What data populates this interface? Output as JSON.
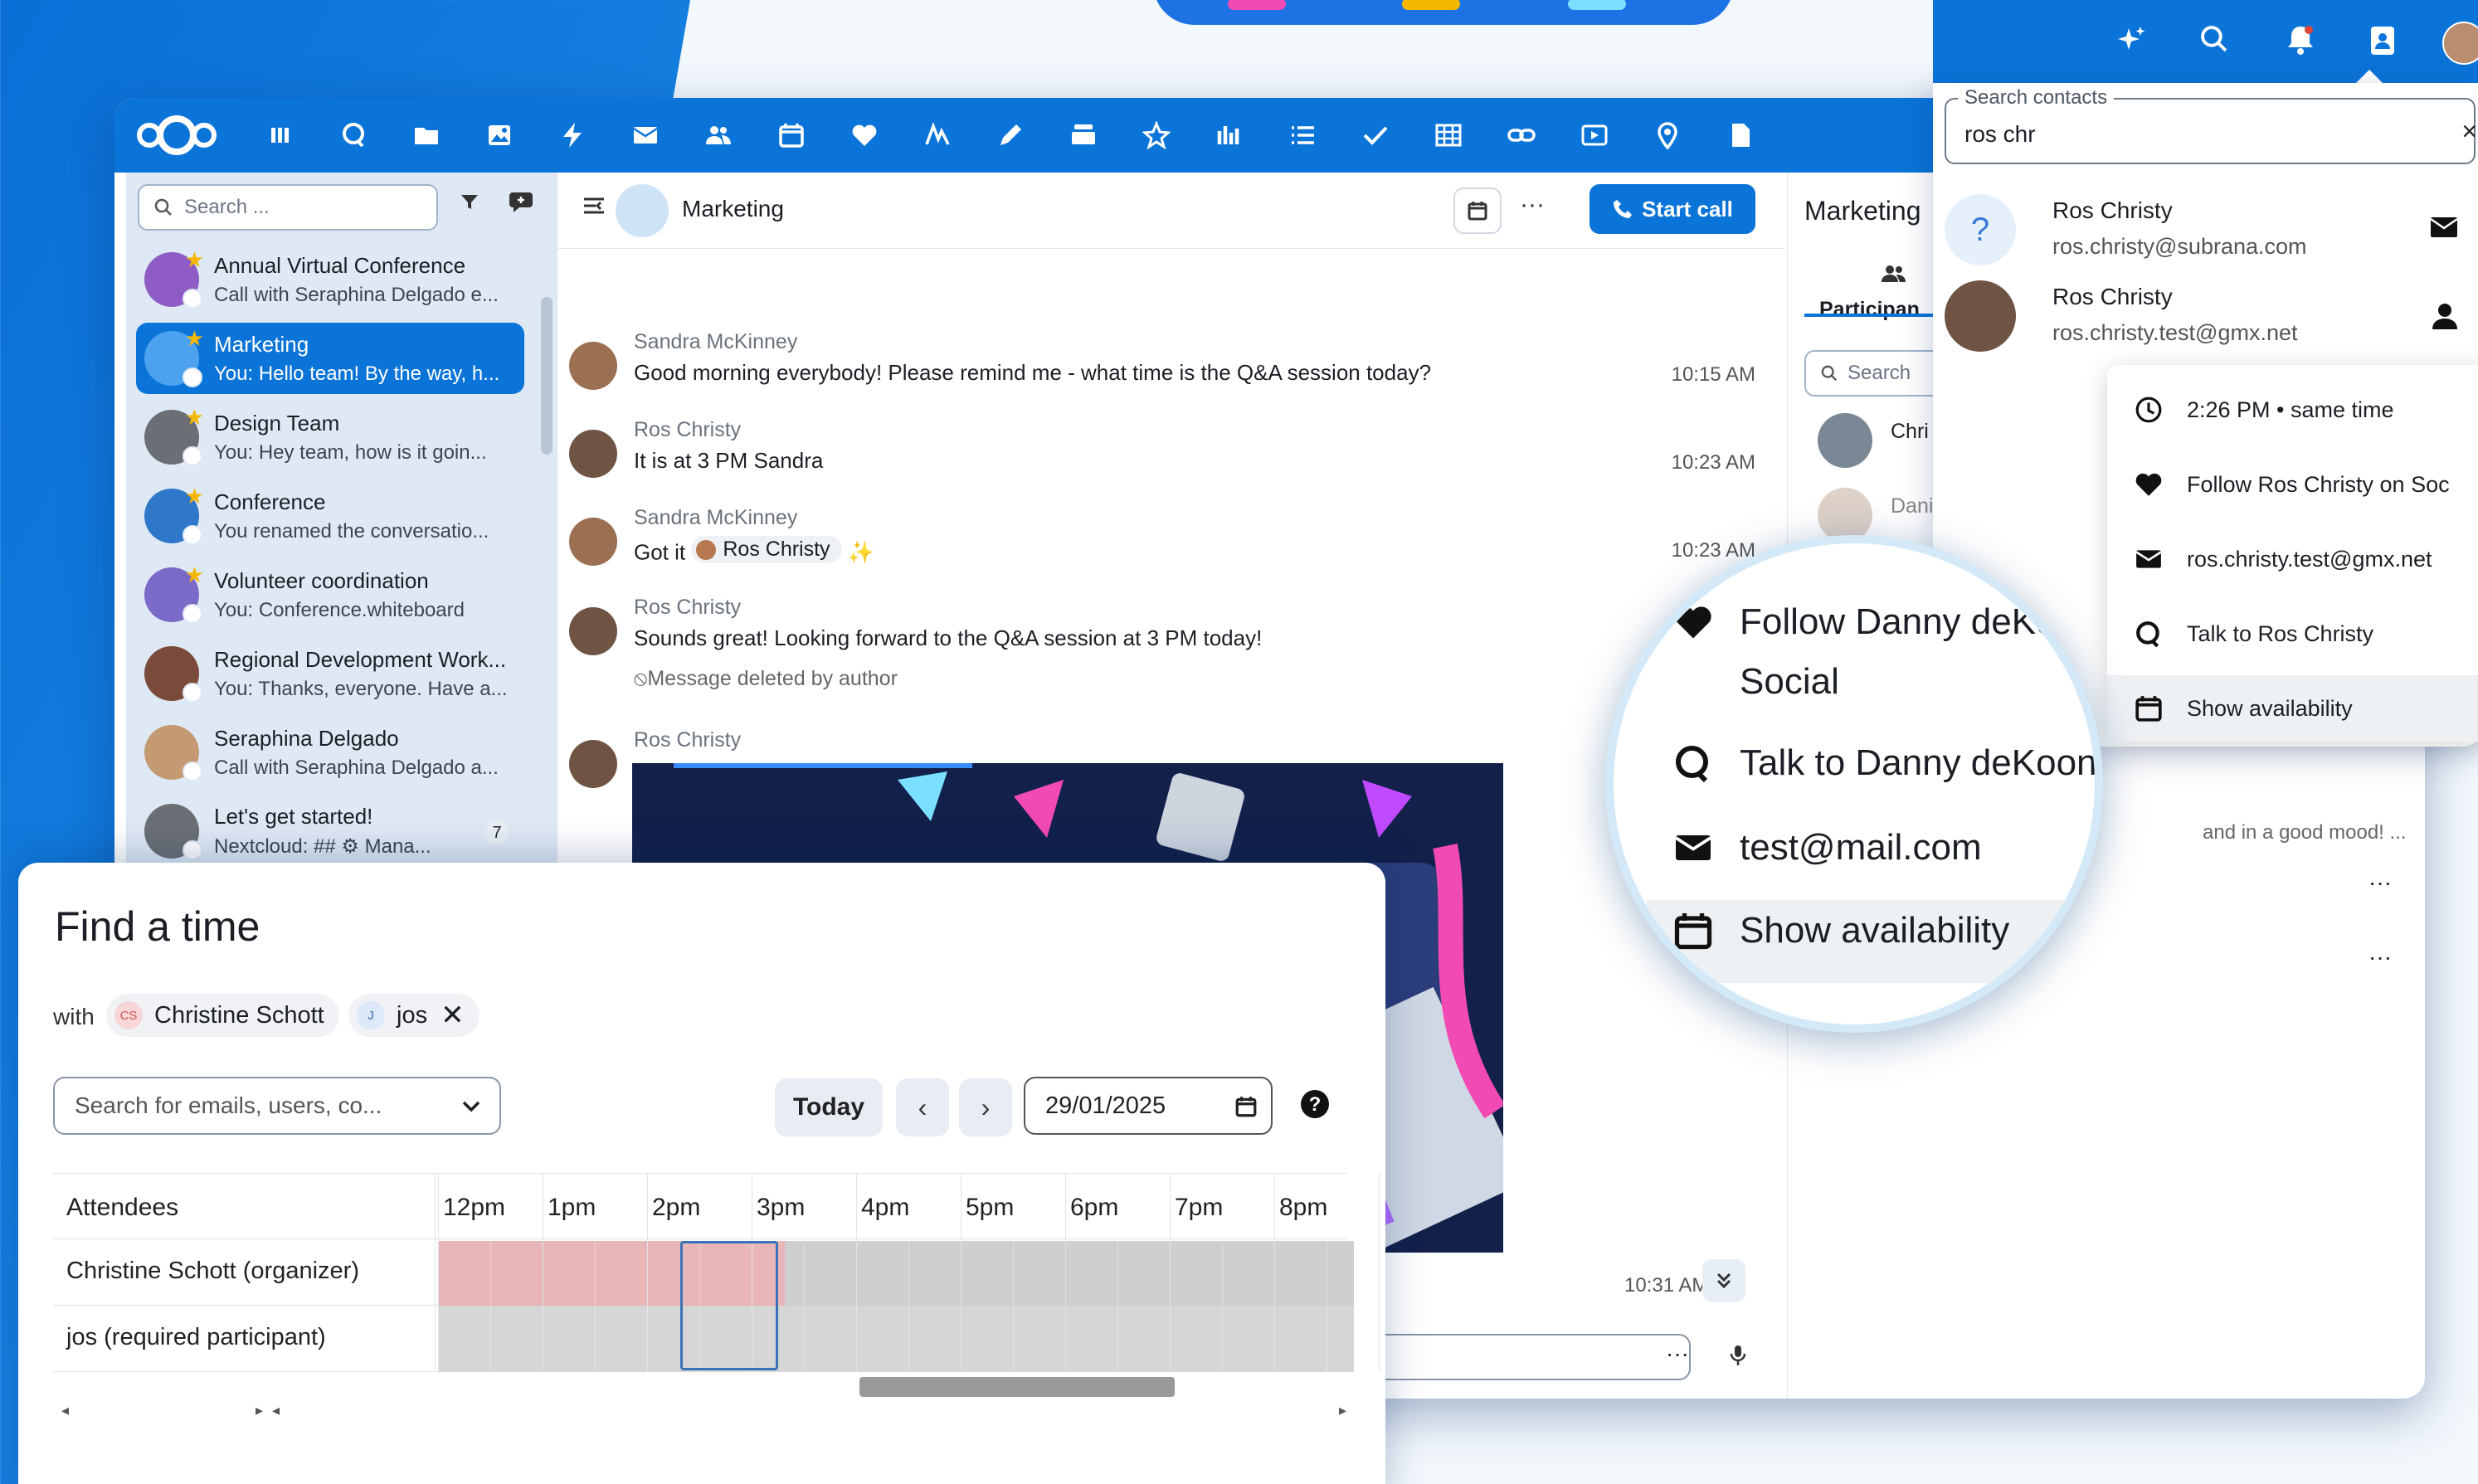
{
  "top_nav": {
    "apps": [
      "dashboard-icon",
      "talk-icon",
      "files-icon",
      "photos-icon",
      "activity-icon",
      "mail-icon",
      "contacts-icon",
      "calendar-icon",
      "heart-icon",
      "notes-icon",
      "pen-icon",
      "deck-icon",
      "sparkle-icon",
      "analytics-icon",
      "tasks-list-icon",
      "checkmark-icon",
      "tables-icon",
      "link-icon",
      "video-icon",
      "maps-icon",
      "document-icon"
    ],
    "right_icons": [
      "assistant-icon",
      "search-icon",
      "notifications-icon",
      "contacts-menu-icon",
      "user-avatar"
    ]
  },
  "sidebar": {
    "search_placeholder": "Search ...",
    "conversations": [
      {
        "name": "Annual Virtual Conference",
        "sub": "Call with Seraphina Delgado e...",
        "favorite": true,
        "color": "#8e5cc4"
      },
      {
        "name": "Marketing",
        "sub": "You: Hello team! By the way, h...",
        "favorite": true,
        "active": true,
        "color": "#4da2f0"
      },
      {
        "name": "Design Team",
        "sub": "You: Hey team, how is it goin...",
        "favorite": true,
        "color": "#6b6f75"
      },
      {
        "name": "Conference",
        "sub": "You renamed the conversatio...",
        "favorite": true,
        "color": "#2f77c9"
      },
      {
        "name": "Volunteer coordination",
        "sub": "You: Conference.whiteboard",
        "favorite": true,
        "color": "#7c6ac9"
      },
      {
        "name": "Regional Development Work...",
        "sub": "You: Thanks, everyone. Have a...",
        "favorite": false,
        "color": "#7a4a3a"
      },
      {
        "name": "Seraphina Delgado",
        "sub": "Call with Seraphina Delgado a...",
        "favorite": false,
        "color": "#c49a72"
      },
      {
        "name": "Let's get started!",
        "sub": "Nextcloud: ## ⚙ Mana...",
        "favorite": false,
        "color": "#6b6f75",
        "badge": "7"
      }
    ]
  },
  "chat": {
    "title": "Marketing",
    "start_call": "Start call",
    "messages": [
      {
        "author": "Sandra McKinney",
        "text": "Good morning everybody! Please remind me - what time is the Q&A session today?",
        "time": "10:15 AM"
      },
      {
        "author": "Ros Christy",
        "text": "It is at 3 PM Sandra",
        "time": "10:23 AM"
      },
      {
        "author": "Sandra McKinney",
        "text": "Got it",
        "mention": "Ros Christy",
        "time": "10:23 AM"
      },
      {
        "author": "Ros Christy",
        "text": "Sounds great! Looking forward to the Q&A session at 3 PM today!",
        "time": "",
        "deleted": "Message deleted by author"
      },
      {
        "author": "Ros Christy",
        "text": "",
        "time": ""
      }
    ],
    "last_time": "10:31 AM"
  },
  "right_panel": {
    "title": "Marketing",
    "tab": "Participan",
    "search_placeholder": "Search",
    "participants": [
      "Chri",
      "Dani"
    ],
    "message_preview": "and in a good mood! ..."
  },
  "contacts_popup": {
    "field_label": "Search contacts",
    "field_value": "ros chr",
    "results": [
      {
        "name": "Ros Christy",
        "email": "ros.christy@subrana.com",
        "avatar": "?"
      },
      {
        "name": "Ros Christy",
        "email": "ros.christy.test@gmx.net",
        "avatar": ""
      }
    ],
    "menu": [
      {
        "icon": "clock-icon",
        "label": "2:26 PM • same time"
      },
      {
        "icon": "heart-icon",
        "label": "Follow Ros Christy on Soc"
      },
      {
        "icon": "mail-icon",
        "label": "ros.christy.test@gmx.net"
      },
      {
        "icon": "talk-icon",
        "label": "Talk to Ros Christy"
      },
      {
        "icon": "calendar-icon",
        "label": "Show availability"
      }
    ]
  },
  "magnifier": {
    "items": [
      {
        "icon": "heart-icon",
        "label": "Follow Danny deKo"
      },
      {
        "icon": "",
        "label": "Social"
      },
      {
        "icon": "talk-icon",
        "label": "Talk to Danny deKoon"
      },
      {
        "icon": "mail-icon",
        "label": "test@mail.com"
      },
      {
        "icon": "calendar-icon",
        "label": "Show availability"
      }
    ]
  },
  "find_time": {
    "title": "Find a time",
    "with_label": "with",
    "chips": [
      {
        "initials": "CS",
        "name": "Christine Schott",
        "removable": false
      },
      {
        "initials": "J",
        "name": "jos",
        "removable": true
      }
    ],
    "search_placeholder": "Search for emails, users, co...",
    "today": "Today",
    "prev": "‹",
    "next": "›",
    "date": "29/01/2025",
    "attendees_header": "Attendees",
    "hours": [
      "12pm",
      "1pm",
      "2pm",
      "3pm",
      "4pm",
      "5pm",
      "6pm",
      "7pm",
      "8pm"
    ],
    "rows": [
      "Christine Schott (organizer)",
      "jos (required participant)"
    ]
  }
}
